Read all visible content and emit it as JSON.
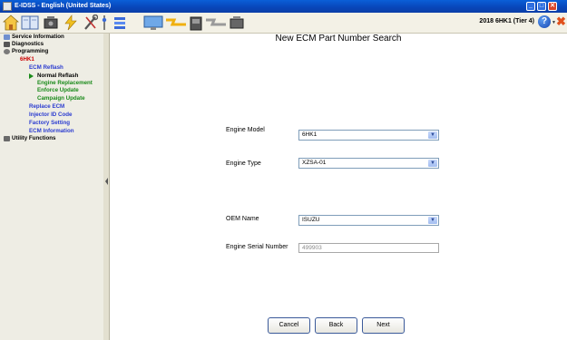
{
  "window": {
    "title": "E-IDSS - English (United States)",
    "minimize": "_",
    "maximize": "□",
    "close": "✕"
  },
  "toolbar": {
    "status": "2018 6HK1 (Tier 4)",
    "help": "?",
    "help_caret": "▼",
    "exit": "✖",
    "icons": [
      "home-icon",
      "book-icon",
      "engine-icon",
      "flash-icon",
      "tools-icon",
      "pin-icon",
      "monitor-icon",
      "bolt-icon",
      "device-icon",
      "plug-icon",
      "engine-small-icon"
    ]
  },
  "sidebar": {
    "items": [
      {
        "label": "Service Information"
      },
      {
        "label": "Diagnostics"
      },
      {
        "label": "Programming"
      },
      {
        "label": "6HK1"
      },
      {
        "label": "ECM Reflash"
      },
      {
        "label": "Normal Reflash"
      },
      {
        "label": "Engine Replacement"
      },
      {
        "label": "Enforce Update"
      },
      {
        "label": "Campaign Update"
      },
      {
        "label": "Replace ECM"
      },
      {
        "label": "Injector ID Code"
      },
      {
        "label": "Factory Setting"
      },
      {
        "label": "ECM Information"
      },
      {
        "label": "Utility Functions"
      }
    ],
    "colors": {
      "red": "#cc0000",
      "blue": "#2a3bd0",
      "green": "#1a8a1a",
      "black": "#000000"
    }
  },
  "main": {
    "title": "New ECM Part Number Search",
    "fields": {
      "engine_model": {
        "label": "Engine Model",
        "value": "6HK1"
      },
      "engine_type": {
        "label": "Engine Type",
        "value": "XZSA-01"
      },
      "oem_name": {
        "label": "OEM Name",
        "value": "ISUZU"
      },
      "engine_serial": {
        "label": "Engine Serial Number",
        "placeholder": "499903"
      }
    },
    "buttons": {
      "cancel": "Cancel",
      "back": "Back",
      "next": "Next"
    }
  }
}
